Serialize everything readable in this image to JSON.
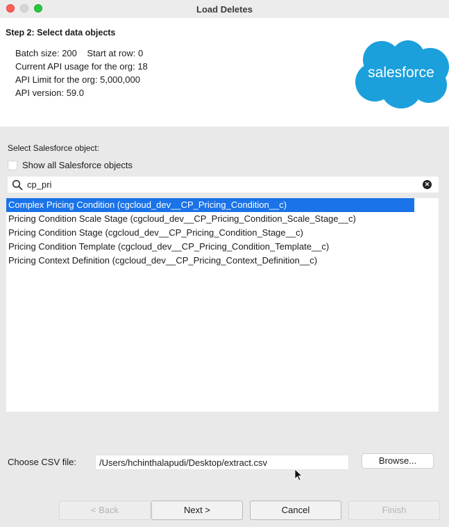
{
  "window": {
    "title": "Load Deletes"
  },
  "header": {
    "step_title": "Step 2: Select data objects",
    "batch_line": "Batch size: 200    Start at row: 0",
    "api_usage": "Current API usage for the org: 18",
    "api_limit": "API Limit for the org: 5,000,000",
    "api_version": "API version: 59.0",
    "logo_text": "salesforce",
    "logo_color": "#1ba0db"
  },
  "object_selector": {
    "label": "Select Salesforce object:",
    "show_all_label": "Show all Salesforce objects",
    "show_all_checked": false,
    "search_value": "cp_pri",
    "items": [
      {
        "label": "Complex Pricing Condition (cgcloud_dev__CP_Pricing_Condition__c)",
        "selected": true
      },
      {
        "label": "Pricing Condition Scale Stage (cgcloud_dev__CP_Pricing_Condition_Scale_Stage__c)",
        "selected": false
      },
      {
        "label": "Pricing Condition Stage (cgcloud_dev__CP_Pricing_Condition_Stage__c)",
        "selected": false
      },
      {
        "label": "Pricing Condition Template (cgcloud_dev__CP_Pricing_Condition_Template__c)",
        "selected": false
      },
      {
        "label": "Pricing Context Definition (cgcloud_dev__CP_Pricing_Context_Definition__c)",
        "selected": false
      }
    ]
  },
  "csv": {
    "label": "Choose CSV file:",
    "path": "/Users/hchinthalapudi/Desktop/extract.csv",
    "browse_label": "Browse..."
  },
  "footer": {
    "back_label": "< Back",
    "next_label": "Next >",
    "cancel_label": "Cancel",
    "finish_label": "Finish"
  },
  "colors": {
    "selection": "#1a73e8",
    "close": "#fe5f57",
    "maximize": "#28c840"
  }
}
